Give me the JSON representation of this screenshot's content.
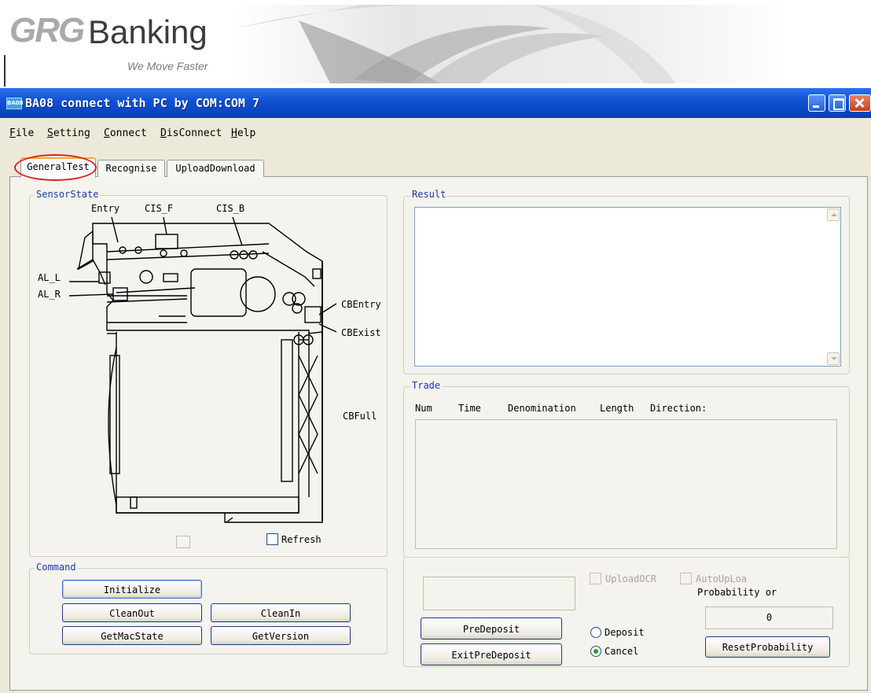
{
  "banner": {
    "logo_grg": "GRG",
    "logo_banking": "Banking",
    "tagline": "We Move Faster"
  },
  "window": {
    "title": "BA08 connect with PC by COM:COM 7",
    "icon_label": "BA08"
  },
  "menu": [
    {
      "accel": "F",
      "rest": "ile"
    },
    {
      "accel": "S",
      "rest": "etting"
    },
    {
      "accel": "C",
      "rest": "onnect"
    },
    {
      "accel": "D",
      "rest": "isConnect"
    },
    {
      "accel": "H",
      "rest": "elp"
    }
  ],
  "tabs": [
    "GeneralTest",
    "Recognise",
    "UploadDownload"
  ],
  "sensor_state": {
    "title": "SensorState",
    "labels": {
      "entry": "Entry",
      "cis_f": "CIS_F",
      "cis_b": "CIS_B",
      "al_l": "AL_L",
      "al_r": "AL_R",
      "cb_entry": "CBEntry",
      "cb_exist": "CBExist",
      "cb_full": "CBFull"
    },
    "refresh_label": "Refresh"
  },
  "command": {
    "title": "Command",
    "buttons": {
      "initialize": "Initialize",
      "clean_out": "CleanOut",
      "clean_in": "CleanIn",
      "get_mac_state": "GetMacState",
      "get_version": "GetVersion"
    }
  },
  "result": {
    "title": "Result"
  },
  "trade": {
    "title": "Trade",
    "columns": [
      "Num",
      "Time",
      "Denomination",
      "Length",
      "Direction:"
    ]
  },
  "controls": {
    "upload_ocr": "UploadOCR",
    "auto_upload": "AutoUpLoa",
    "probability_label": "Probability or",
    "probability_value": "0",
    "reset_probability": "ResetProbability",
    "pre_deposit": "PreDeposit",
    "exit_pre_deposit": "ExitPreDeposit",
    "radio_deposit": "Deposit",
    "radio_cancel": "Cancel"
  }
}
